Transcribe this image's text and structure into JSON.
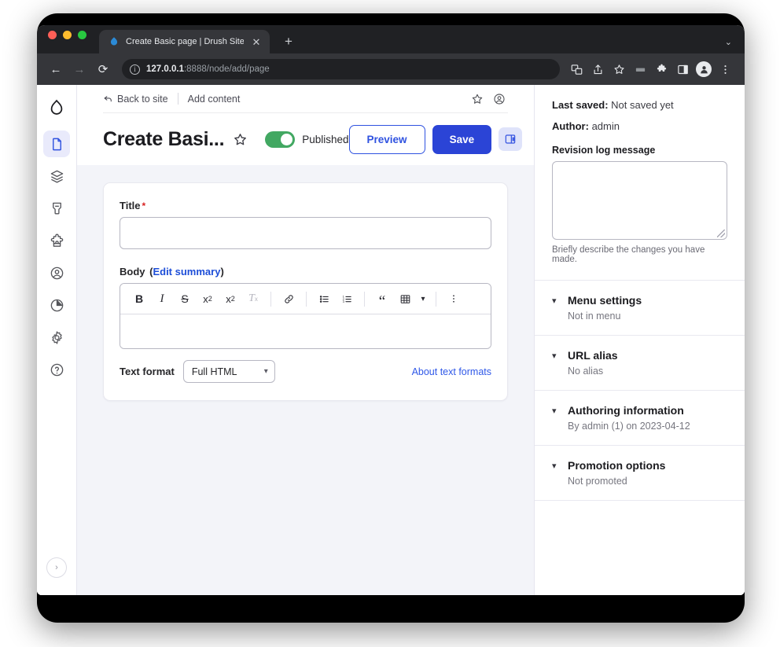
{
  "browser": {
    "tab": {
      "title": "Create Basic page | Drush Site-",
      "favicon": "drupal-droplet-icon",
      "close_label": "✕"
    },
    "new_tab_label": "+",
    "tabstrip_caret": "⌄",
    "nav": {
      "back": "←",
      "forward": "→",
      "reload": "⟳"
    },
    "url": {
      "host": "127.0.0.1",
      "rest": ":8888/node/add/page",
      "info_glyph": "i"
    },
    "toolbar_icons": [
      "translate-icon",
      "share-icon",
      "bookmark-star-icon",
      "extensions-grid-icon",
      "puzzle-extension-icon",
      "side-panel-icon",
      "profile-avatar-icon",
      "more-vert-icon"
    ]
  },
  "rail": {
    "logo": "drupal-droplet-logo",
    "items": [
      {
        "name": "content",
        "icon": "file-document-icon",
        "active": true
      },
      {
        "name": "structure",
        "icon": "layers-stack-icon",
        "active": false
      },
      {
        "name": "appearance",
        "icon": "paint-brush-icon",
        "active": false
      },
      {
        "name": "extend",
        "icon": "puzzle-piece-icon",
        "active": false
      },
      {
        "name": "people",
        "icon": "user-circle-icon",
        "active": false
      },
      {
        "name": "reports",
        "icon": "pie-chart-icon",
        "active": false
      },
      {
        "name": "configuration",
        "icon": "gear-icon",
        "active": false
      },
      {
        "name": "help",
        "icon": "question-circle-icon",
        "active": false
      }
    ],
    "collapse_glyph": "›"
  },
  "header": {
    "back_to_site": "Back to site",
    "back_arrow": "↩",
    "add_content": "Add content",
    "shortcut_star_icon": "star-outline-icon",
    "account_icon": "user-circle-icon",
    "page_title": "Create Basi...",
    "title_star_icon": "star-outline-icon",
    "published_label": "Published",
    "published_state": true,
    "preview_label": "Preview",
    "save_label": "Save",
    "sidebar_toggle_icon": "side-panel-toggle-icon"
  },
  "form": {
    "title_label": "Title",
    "title_required_mark": "*",
    "title_value": "",
    "body_label": "Body",
    "body_edit_summary": "Edit summary",
    "body_value": "",
    "editor_toolbar": [
      {
        "name": "bold",
        "glyph": "B",
        "disabled": false
      },
      {
        "name": "italic",
        "glyph": "I",
        "disabled": false
      },
      {
        "name": "strikethrough",
        "glyph": "S",
        "disabled": false
      },
      {
        "name": "superscript",
        "glyph": "x²",
        "disabled": false
      },
      {
        "name": "subscript",
        "glyph": "x₂",
        "disabled": false
      },
      {
        "name": "remove-format",
        "glyph": "Tx",
        "disabled": true
      },
      {
        "name": "link",
        "glyph": "link-icon",
        "disabled": false
      },
      {
        "name": "bulleted-list",
        "glyph": "bulleted-list-icon",
        "disabled": false
      },
      {
        "name": "numbered-list",
        "glyph": "numbered-list-icon",
        "disabled": false
      },
      {
        "name": "blockquote",
        "glyph": "“",
        "disabled": false
      },
      {
        "name": "insert-table",
        "glyph": "table-icon",
        "disabled": false
      },
      {
        "name": "show-more-items",
        "glyph": "more-vert-icon",
        "disabled": false
      }
    ],
    "text_format_label": "Text format",
    "text_format_value": "Full HTML",
    "text_format_options": [
      "Full HTML"
    ],
    "about_text_formats": "About text formats"
  },
  "sidebar": {
    "last_saved_label": "Last saved:",
    "last_saved_value": "Not saved yet",
    "author_label": "Author:",
    "author_value": "admin",
    "revision_log_label": "Revision log message",
    "revision_log_value": "",
    "revision_help": "Briefly describe the changes you have made.",
    "caret_glyph": "⌄",
    "accordions": [
      {
        "title": "Menu settings",
        "summary": "Not in menu"
      },
      {
        "title": "URL alias",
        "summary": "No alias"
      },
      {
        "title": "Authoring information",
        "summary": "By admin (1) on 2023-04-12"
      },
      {
        "title": "Promotion options",
        "summary": "Not promoted"
      }
    ]
  },
  "colors": {
    "drupal_blue": "#2b44d6",
    "link_blue": "#1d4ed8",
    "published_green": "#42a862",
    "required_red": "#d72222",
    "app_bg": "#f3f4f9",
    "chrome_dark": "#202124"
  }
}
